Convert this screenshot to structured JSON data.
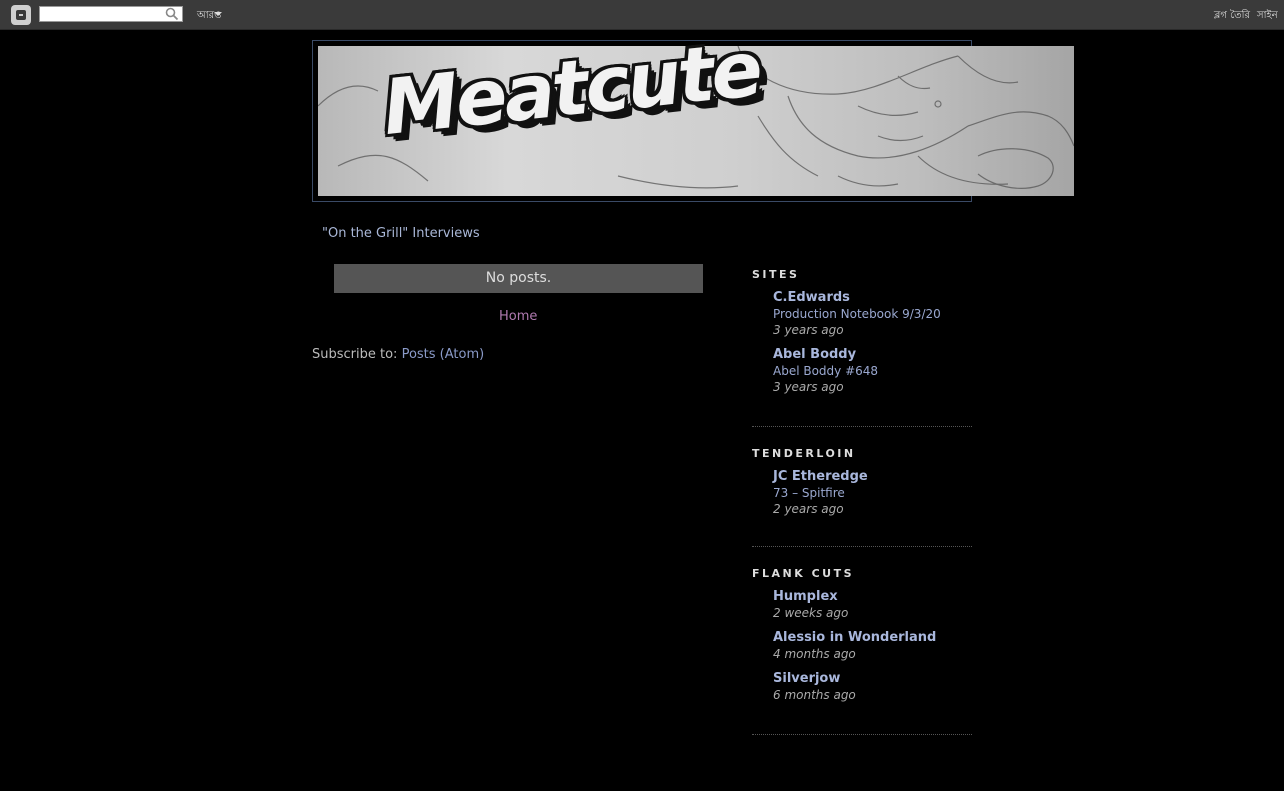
{
  "navbar": {
    "more_label": "আরও",
    "right_link_1": "ব্লগ তৈরি",
    "right_link_2": "সাইন"
  },
  "header": {
    "title": "Meatcute"
  },
  "pages": {
    "interviews_label": "\"On the Grill\" Interviews"
  },
  "main": {
    "no_posts": "No posts.",
    "home_label": "Home",
    "subscribe_prefix": "Subscribe to: ",
    "subscribe_link": "Posts (Atom)"
  },
  "sidebar": {
    "sections": [
      {
        "heading": "SITES",
        "entries": [
          {
            "name": "C.Edwards",
            "post": "Production Notebook 9/3/20",
            "time": "3 years ago"
          },
          {
            "name": "Abel Boddy",
            "post": "Abel Boddy #648",
            "time": "3 years ago"
          }
        ]
      },
      {
        "heading": "TENDERLOIN",
        "entries": [
          {
            "name": "JC Etheredge",
            "post": "73 – Spitfire",
            "time": "2 years ago"
          }
        ]
      },
      {
        "heading": "FLANK CUTS",
        "entries": [
          {
            "name": "Humplex",
            "post": "",
            "time": "2 weeks ago"
          },
          {
            "name": "Alessio in Wonderland",
            "post": "",
            "time": "4 months ago"
          },
          {
            "name": "Silverjow",
            "post": "",
            "time": "6 months ago"
          }
        ]
      }
    ]
  },
  "colors": {
    "background": "#000000",
    "link": "#a9b7dc",
    "home_link": "#b07ab0",
    "navbar": "#3a3a3a"
  },
  "icons": [
    "blogger-icon",
    "search-icon",
    "caret-down-icon"
  ]
}
